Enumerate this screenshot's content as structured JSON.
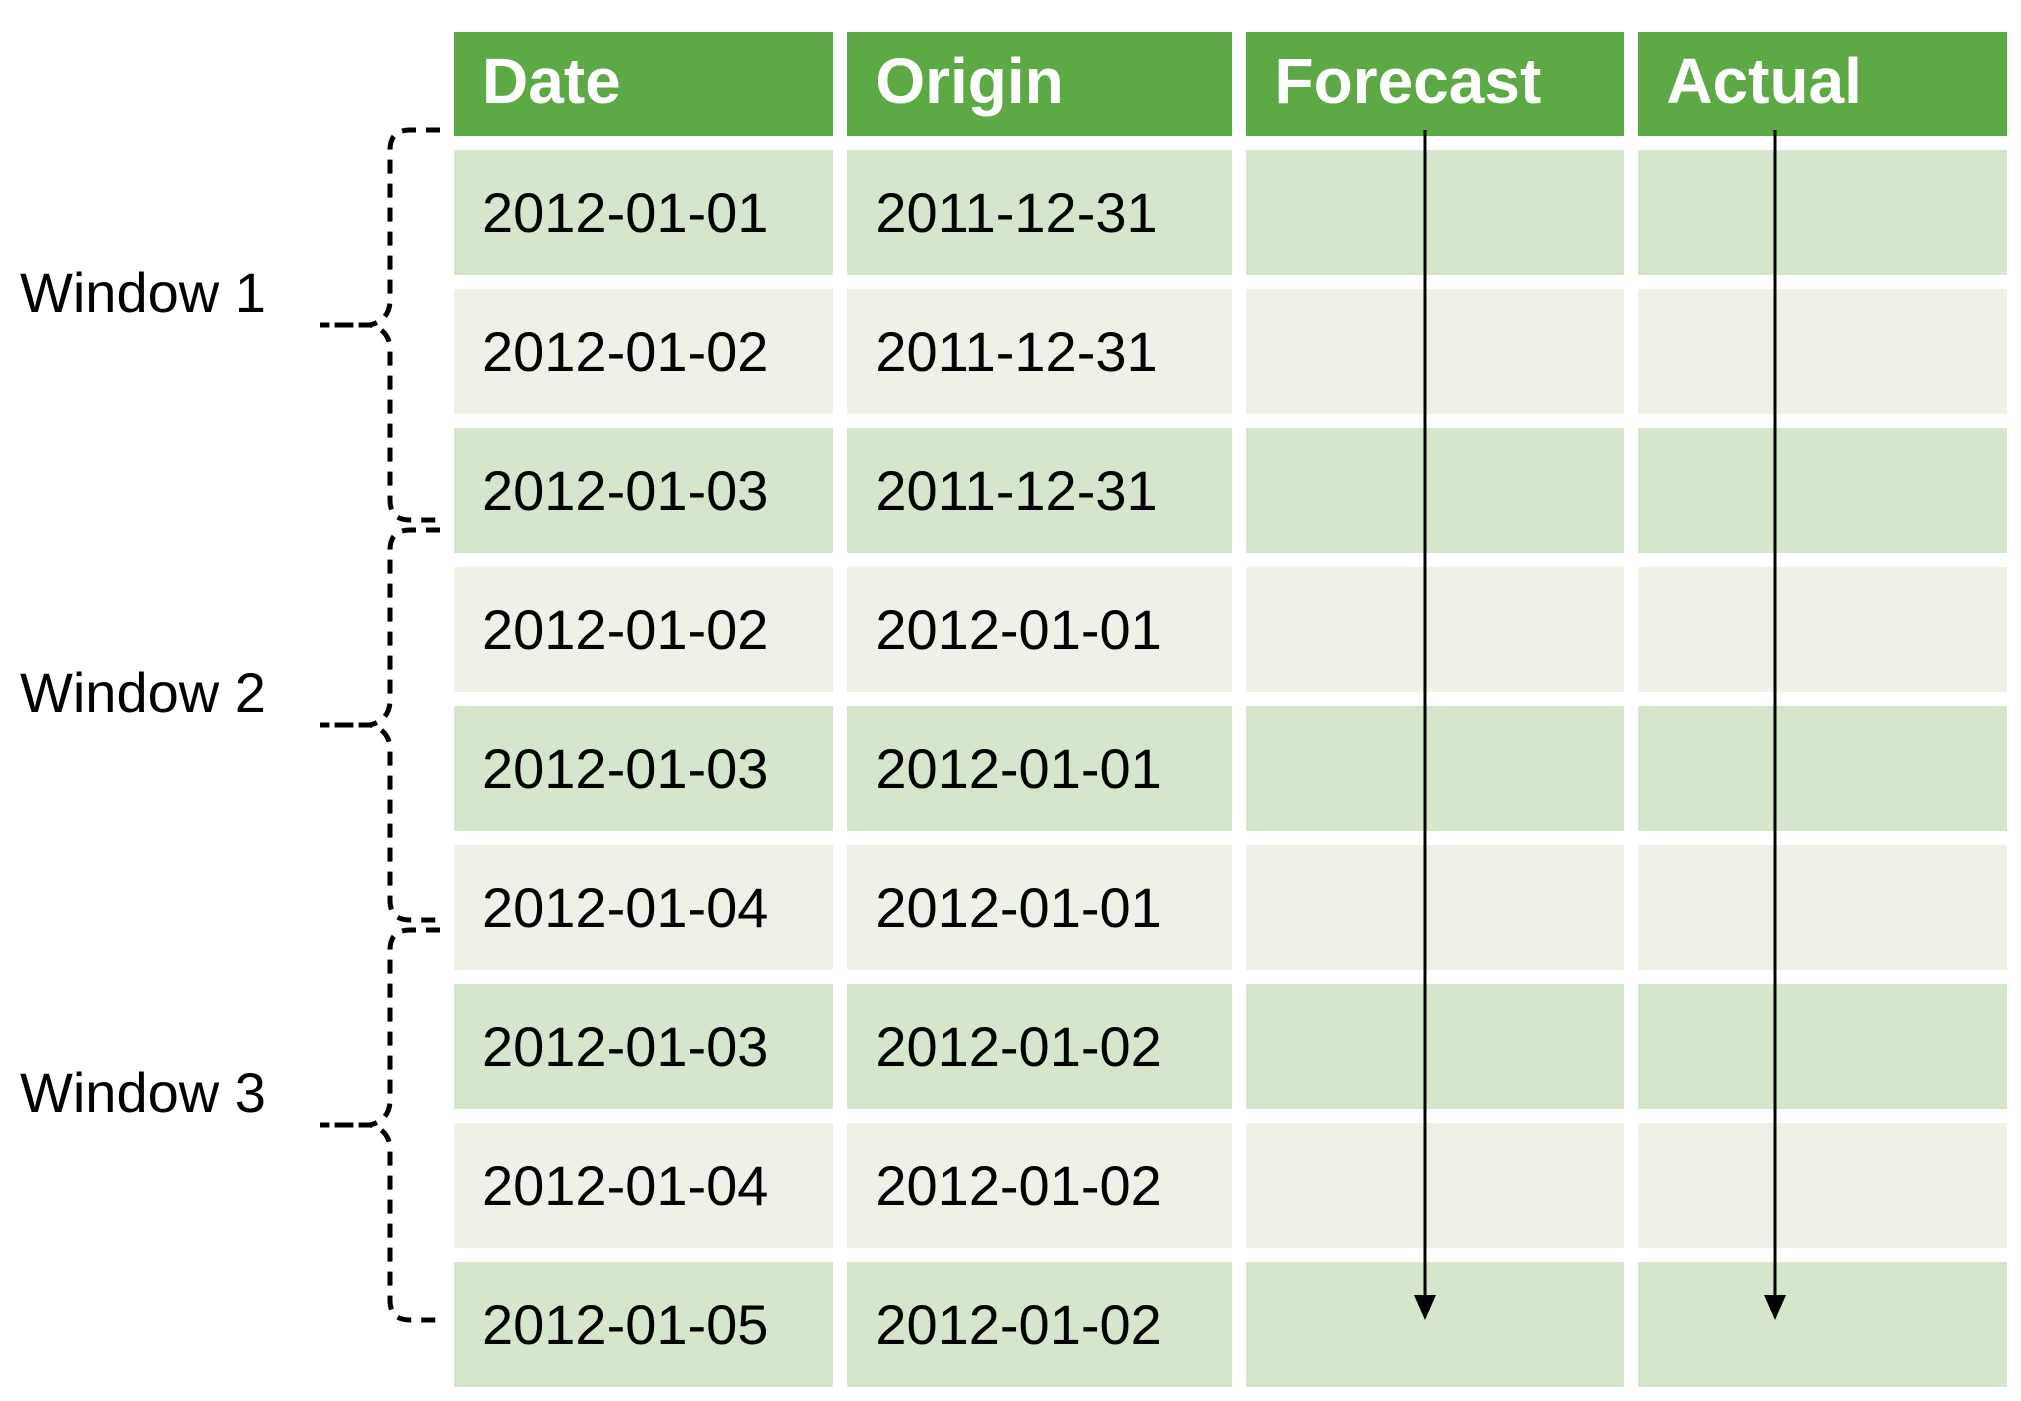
{
  "columns": [
    "Date",
    "Origin",
    "Forecast",
    "Actual"
  ],
  "rows": [
    {
      "date": "2012-01-01",
      "origin": "2011-12-31",
      "forecast": "",
      "actual": ""
    },
    {
      "date": "2012-01-02",
      "origin": "2011-12-31",
      "forecast": "",
      "actual": ""
    },
    {
      "date": "2012-01-03",
      "origin": "2011-12-31",
      "forecast": "",
      "actual": ""
    },
    {
      "date": "2012-01-02",
      "origin": "2012-01-01",
      "forecast": "",
      "actual": ""
    },
    {
      "date": "2012-01-03",
      "origin": "2012-01-01",
      "forecast": "",
      "actual": ""
    },
    {
      "date": "2012-01-04",
      "origin": "2012-01-01",
      "forecast": "",
      "actual": ""
    },
    {
      "date": "2012-01-03",
      "origin": "2012-01-02",
      "forecast": "",
      "actual": ""
    },
    {
      "date": "2012-01-04",
      "origin": "2012-01-02",
      "forecast": "",
      "actual": ""
    },
    {
      "date": "2012-01-05",
      "origin": "2012-01-02",
      "forecast": "",
      "actual": ""
    }
  ],
  "windows": [
    {
      "label": "Window 1",
      "start": 0,
      "end": 2
    },
    {
      "label": "Window 2",
      "start": 3,
      "end": 5
    },
    {
      "label": "Window 3",
      "start": 6,
      "end": 8
    }
  ],
  "colors": {
    "header": "#5ca945",
    "rowDark": "#d6e6cc",
    "rowLight": "#ecf3e6"
  }
}
